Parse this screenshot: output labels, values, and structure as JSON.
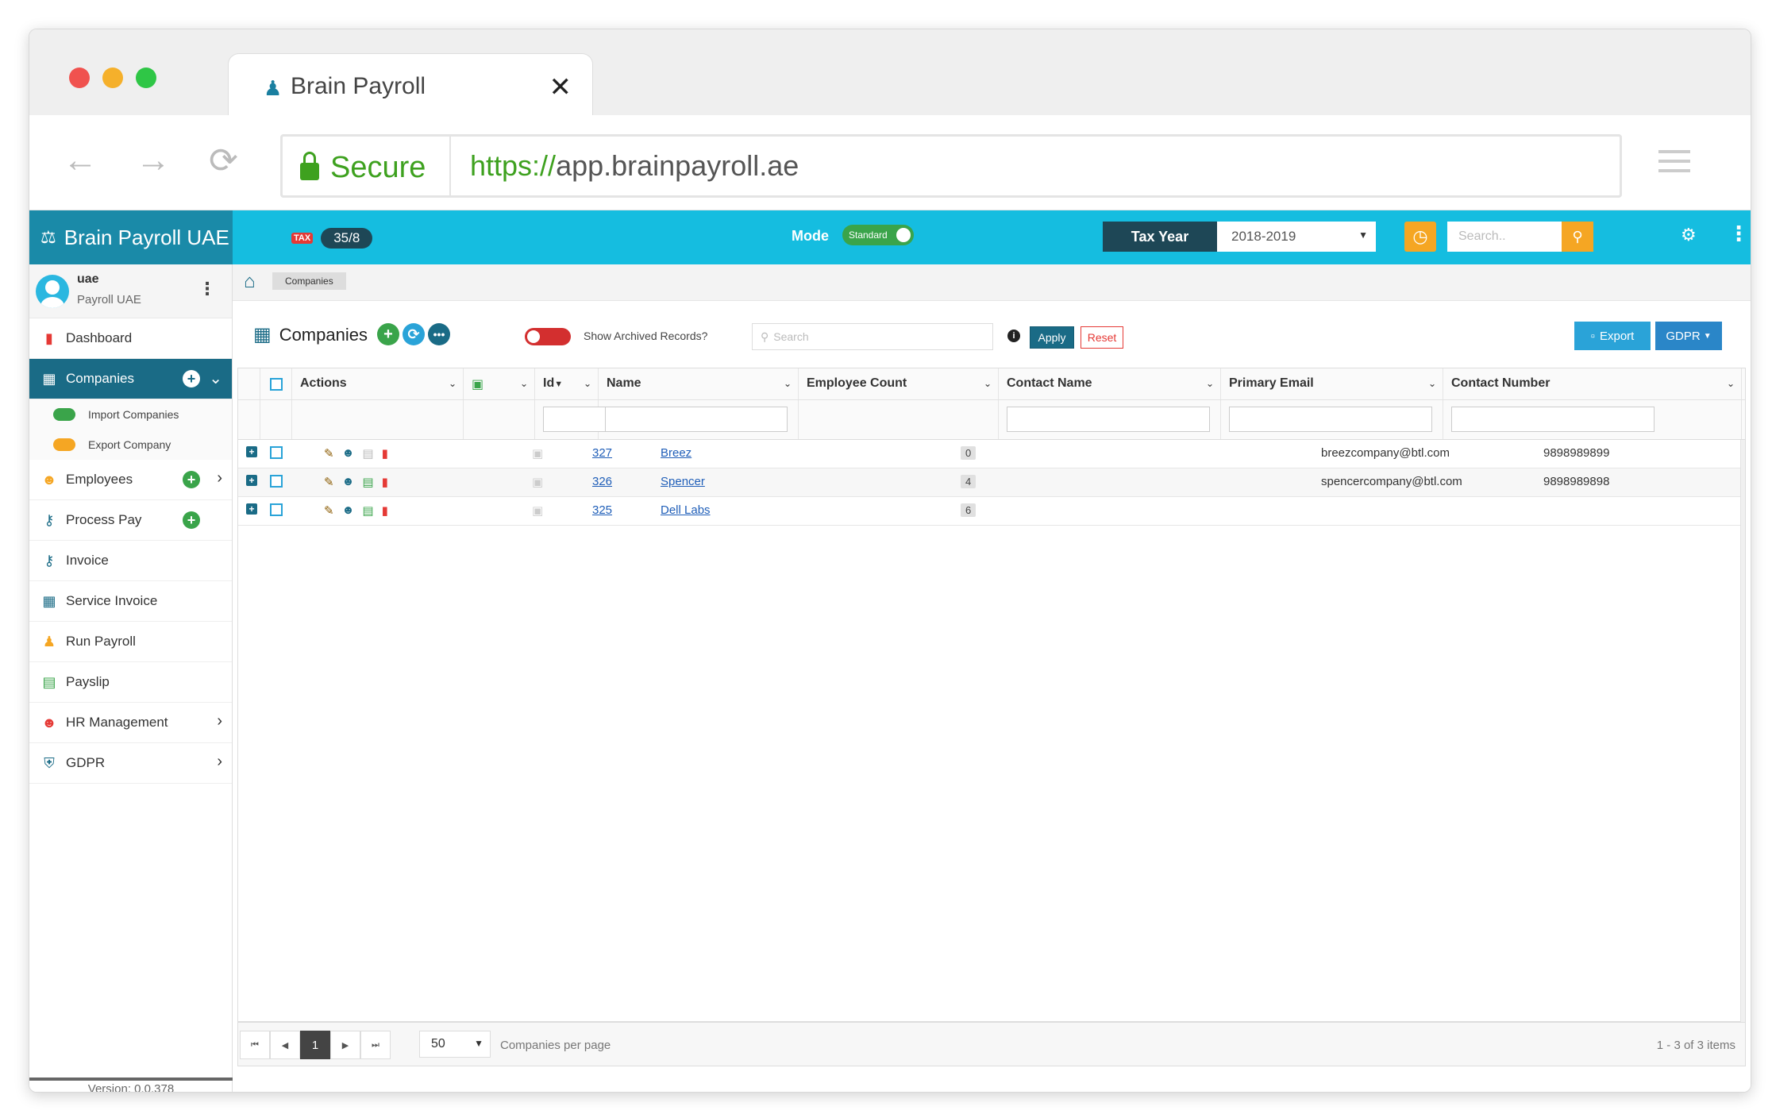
{
  "browser": {
    "tab_title": "Brain Payroll",
    "secure_label": "Secure",
    "url_protocol": "https://",
    "url_host": "app.brainpayroll.ae"
  },
  "topbar": {
    "brand": "Brain Payroll UAE",
    "tax_icon_label": "TAX",
    "tax_count": "35/8",
    "mode_label": "Mode",
    "mode_value": "Standard",
    "tax_year_label": "Tax Year",
    "tax_year_value": "2018-2019",
    "search_placeholder": "Search.."
  },
  "user": {
    "name": "uae",
    "org": "Payroll UAE"
  },
  "sidebar": {
    "items": [
      {
        "label": "Dashboard",
        "icon": "bar-chart-icon",
        "color": "#e53935"
      },
      {
        "label": "Companies",
        "icon": "building-icon",
        "active": true
      },
      {
        "label": "Employees",
        "icon": "people-icon",
        "color": "#f5a623"
      },
      {
        "label": "Process Pay",
        "icon": "key-icon",
        "color": "#1a6b86"
      },
      {
        "label": "Invoice",
        "icon": "key-icon",
        "color": "#1a6b86"
      },
      {
        "label": "Service Invoice",
        "icon": "building-icon",
        "color": "#1a6b86"
      },
      {
        "label": "Run Payroll",
        "icon": "money-bag-icon",
        "color": "#f5a623"
      },
      {
        "label": "Payslip",
        "icon": "payslip-icon",
        "color": "#3aa44a"
      },
      {
        "label": "HR Management",
        "icon": "team-icon",
        "color": "#e53935"
      },
      {
        "label": "GDPR",
        "icon": "shield-icon",
        "color": "#1a6b86"
      }
    ],
    "sub_items": [
      {
        "label": "Import Companies",
        "color": "#3aa44a"
      },
      {
        "label": "Export Company",
        "color": "#f5a623"
      }
    ],
    "version": "Version: 0.0.378"
  },
  "breadcrumb": {
    "current": "Companies"
  },
  "toolbar": {
    "title": "Companies",
    "archived_label": "Show Archived Records?",
    "search_placeholder": "Search",
    "apply": "Apply",
    "reset": "Reset",
    "export": "Export",
    "gdpr": "GDPR"
  },
  "grid": {
    "columns": [
      "Actions",
      "Id",
      "Name",
      "Employee Count",
      "Contact Name",
      "Primary Email",
      "Contact Number"
    ],
    "rows": [
      {
        "id": "327",
        "name": "Breez",
        "employee_count": "0",
        "contact_name": "",
        "email": "breezcompany@btl.com",
        "phone": "9898989899"
      },
      {
        "id": "326",
        "name": "Spencer",
        "employee_count": "4",
        "contact_name": "",
        "email": "spencercompany@btl.com",
        "phone": "9898989898"
      },
      {
        "id": "325",
        "name": "Dell Labs",
        "employee_count": "6",
        "contact_name": "",
        "email": "",
        "phone": ""
      }
    ]
  },
  "pager": {
    "current_page": "1",
    "per_page": "50",
    "per_page_label": "Companies per page",
    "info": "1 - 3 of 3 items"
  }
}
